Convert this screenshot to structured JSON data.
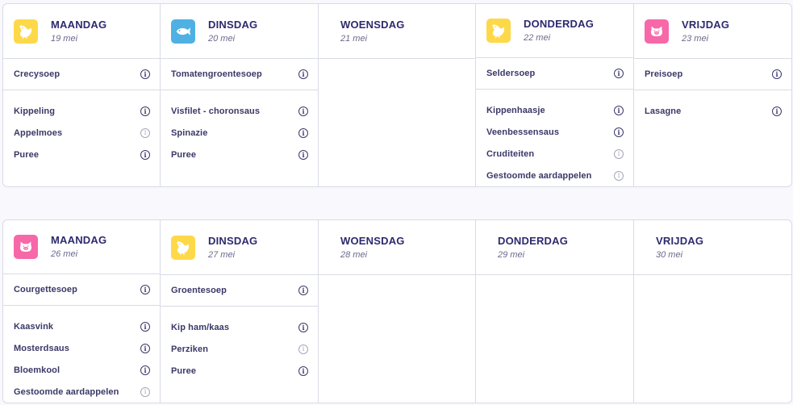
{
  "weeks": [
    {
      "days": [
        {
          "name": "MAANDAG",
          "date": "19 mei",
          "icon": "chicken-icon",
          "color": "#fdd94a",
          "soup": {
            "label": "Crecysoep",
            "info": "active"
          },
          "items": [
            {
              "label": "Kippeling",
              "info": "active"
            },
            {
              "label": "Appelmoes",
              "info": "muted"
            },
            {
              "label": "Puree",
              "info": "active"
            }
          ]
        },
        {
          "name": "DINSDAG",
          "date": "20 mei",
          "icon": "fish-icon",
          "color": "#4fb0e3",
          "soup": {
            "label": "Tomatengroentesoep",
            "info": "active"
          },
          "items": [
            {
              "label": "Visfilet - choronsaus",
              "info": "active"
            },
            {
              "label": "Spinazie",
              "info": "active"
            },
            {
              "label": "Puree",
              "info": "active"
            }
          ]
        },
        {
          "name": "WOENSDAG",
          "date": "21 mei",
          "icon": "",
          "color": "",
          "soup": null,
          "items": []
        },
        {
          "name": "DONDERDAG",
          "date": "22 mei",
          "icon": "chicken-icon",
          "color": "#fdd94a",
          "soup": {
            "label": "Seldersoep",
            "info": "active"
          },
          "items": [
            {
              "label": "Kippenhaasje",
              "info": "active"
            },
            {
              "label": "Veenbessensaus",
              "info": "active"
            },
            {
              "label": "Cruditeiten",
              "info": "muted"
            },
            {
              "label": "Gestoomde aardappelen",
              "info": "muted"
            }
          ]
        },
        {
          "name": "VRIJDAG",
          "date": "23 mei",
          "icon": "pig-icon",
          "color": "#f768a8",
          "soup": {
            "label": "Preisoep",
            "info": "active"
          },
          "items": [
            {
              "label": "Lasagne",
              "info": "active"
            }
          ]
        }
      ]
    },
    {
      "days": [
        {
          "name": "MAANDAG",
          "date": "26 mei",
          "icon": "pig-icon",
          "color": "#f768a8",
          "soup": {
            "label": "Courgettesoep",
            "info": "active"
          },
          "items": [
            {
              "label": "Kaasvink",
              "info": "active"
            },
            {
              "label": "Mosterdsaus",
              "info": "active"
            },
            {
              "label": "Bloemkool",
              "info": "active"
            },
            {
              "label": "Gestoomde aardappelen",
              "info": "muted"
            }
          ]
        },
        {
          "name": "DINSDAG",
          "date": "27 mei",
          "icon": "chicken-icon",
          "color": "#fdd94a",
          "soup": {
            "label": "Groentesoep",
            "info": "active"
          },
          "items": [
            {
              "label": "Kip ham/kaas",
              "info": "active"
            },
            {
              "label": "Perziken",
              "info": "muted"
            },
            {
              "label": "Puree",
              "info": "active"
            }
          ]
        },
        {
          "name": "WOENSDAG",
          "date": "28 mei",
          "icon": "",
          "color": "",
          "soup": null,
          "items": []
        },
        {
          "name": "DONDERDAG",
          "date": "29 mei",
          "icon": "",
          "color": "",
          "soup": null,
          "items": []
        },
        {
          "name": "VRIJDAG",
          "date": "30 mei",
          "icon": "",
          "color": "",
          "soup": null,
          "items": []
        }
      ]
    }
  ],
  "info_glyph": "i"
}
